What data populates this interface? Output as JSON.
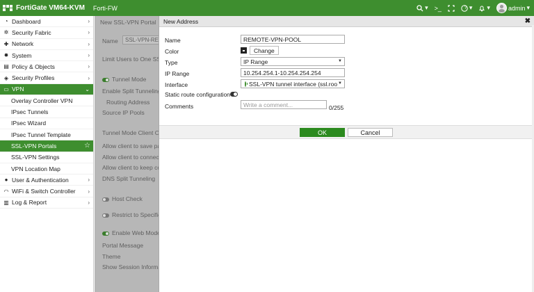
{
  "topbar": {
    "title": "FortiGate VM64-KVM",
    "hostname": "Forti-FW",
    "search_icon": "search-icon",
    "cli_glyph": ">_",
    "help_glyph": "?",
    "alert_glyph": "🔔",
    "user": "admin",
    "colors": {
      "brand": "#3e8e2f"
    }
  },
  "sidebar": {
    "items": [
      {
        "label": "Dashboard",
        "icon": "dashboard-icon",
        "glyph": "◔"
      },
      {
        "label": "Security Fabric",
        "icon": "fabric-icon",
        "glyph": "✲"
      },
      {
        "label": "Network",
        "icon": "network-icon",
        "glyph": "✚"
      },
      {
        "label": "System",
        "icon": "gear-icon",
        "glyph": "✸"
      },
      {
        "label": "Policy & Objects",
        "icon": "policy-icon",
        "glyph": "▤"
      },
      {
        "label": "Security Profiles",
        "icon": "shield-icon",
        "glyph": "◈"
      },
      {
        "label": "VPN",
        "icon": "monitor-icon",
        "glyph": "▭"
      },
      {
        "label": "User & Authentication",
        "icon": "user-icon",
        "glyph": "●"
      },
      {
        "label": "WiFi & Switch Controller",
        "icon": "wifi-icon",
        "glyph": "◠"
      },
      {
        "label": "Log & Report",
        "icon": "chart-icon",
        "glyph": "▥"
      }
    ],
    "vpn_sub": [
      "Overlay Controller VPN",
      "IPsec Tunnels",
      "IPsec Wizard",
      "IPsec Tunnel Template",
      "SSL-VPN Portals",
      "SSL-VPN Settings",
      "VPN Location Map"
    ]
  },
  "background": {
    "tab": "New SSL-VPN Portal",
    "name_label": "Name",
    "name_value": "SSL-VPN-REM",
    "limit_users": "Limit Users to One SSL",
    "tunnel_mode": "Tunnel Mode",
    "split_tunneling": "Enable Split Tunneling",
    "routing_address": "Routing Address",
    "source_ip_pools": "Source IP Pools",
    "tunnel_client_opts": "Tunnel Mode Client Op",
    "allow_save": "Allow client to save pa",
    "allow_connect": "Allow client to connect",
    "allow_keep": "Allow client to keep co",
    "dns_split": "DNS Split Tunneling",
    "host_check": "Host Check",
    "restrict": "Restrict to Specific",
    "web_mode": "Enable Web Mode",
    "portal_message": "Portal Message",
    "theme": "Theme",
    "show_session": "Show Session Informat"
  },
  "dialog": {
    "title": "New Address",
    "labels": {
      "name": "Name",
      "color": "Color",
      "type": "Type",
      "ip_range": "IP Range",
      "interface": "Interface",
      "static_route": "Static route configuration",
      "comments": "Comments"
    },
    "values": {
      "name": "REMOTE-VPN-POOL",
      "change": "Change",
      "type": "IP Range",
      "ip_range": "10.254.254.1-10.254.254.254",
      "interface": "SSL-VPN tunnel interface (ssl.roo",
      "comment_placeholder": "Write a comment...",
      "counter": "0/255"
    },
    "buttons": {
      "ok": "OK",
      "cancel": "Cancel"
    }
  }
}
